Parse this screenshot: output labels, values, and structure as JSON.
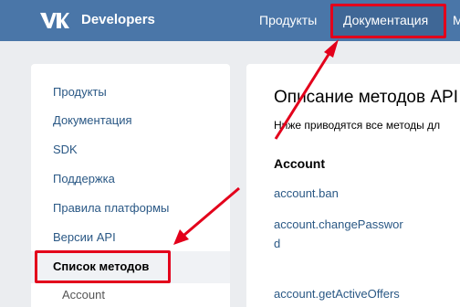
{
  "header": {
    "brand": "Developers",
    "nav": [
      "Продукты",
      "Документация",
      "М"
    ]
  },
  "sidebar": {
    "items": [
      "Продукты",
      "Документация",
      "SDK",
      "Поддержка",
      "Правила платформы",
      "Версии API"
    ],
    "active_item": "Список методов",
    "sub_item": "Account"
  },
  "content": {
    "title": "Описание методов API",
    "description": "Ниже приводятся все методы дл",
    "section": "Account",
    "methods": [
      "account.ban",
      "account.changePasswor",
      "d",
      "account.getActiveOffers"
    ]
  },
  "icons": {
    "logo": "vk-logo-icon",
    "arrow": "red-arrow-icon"
  },
  "colors": {
    "header_bg": "#4a76a8",
    "link": "#2a5885",
    "annotation": "#e3001b"
  }
}
